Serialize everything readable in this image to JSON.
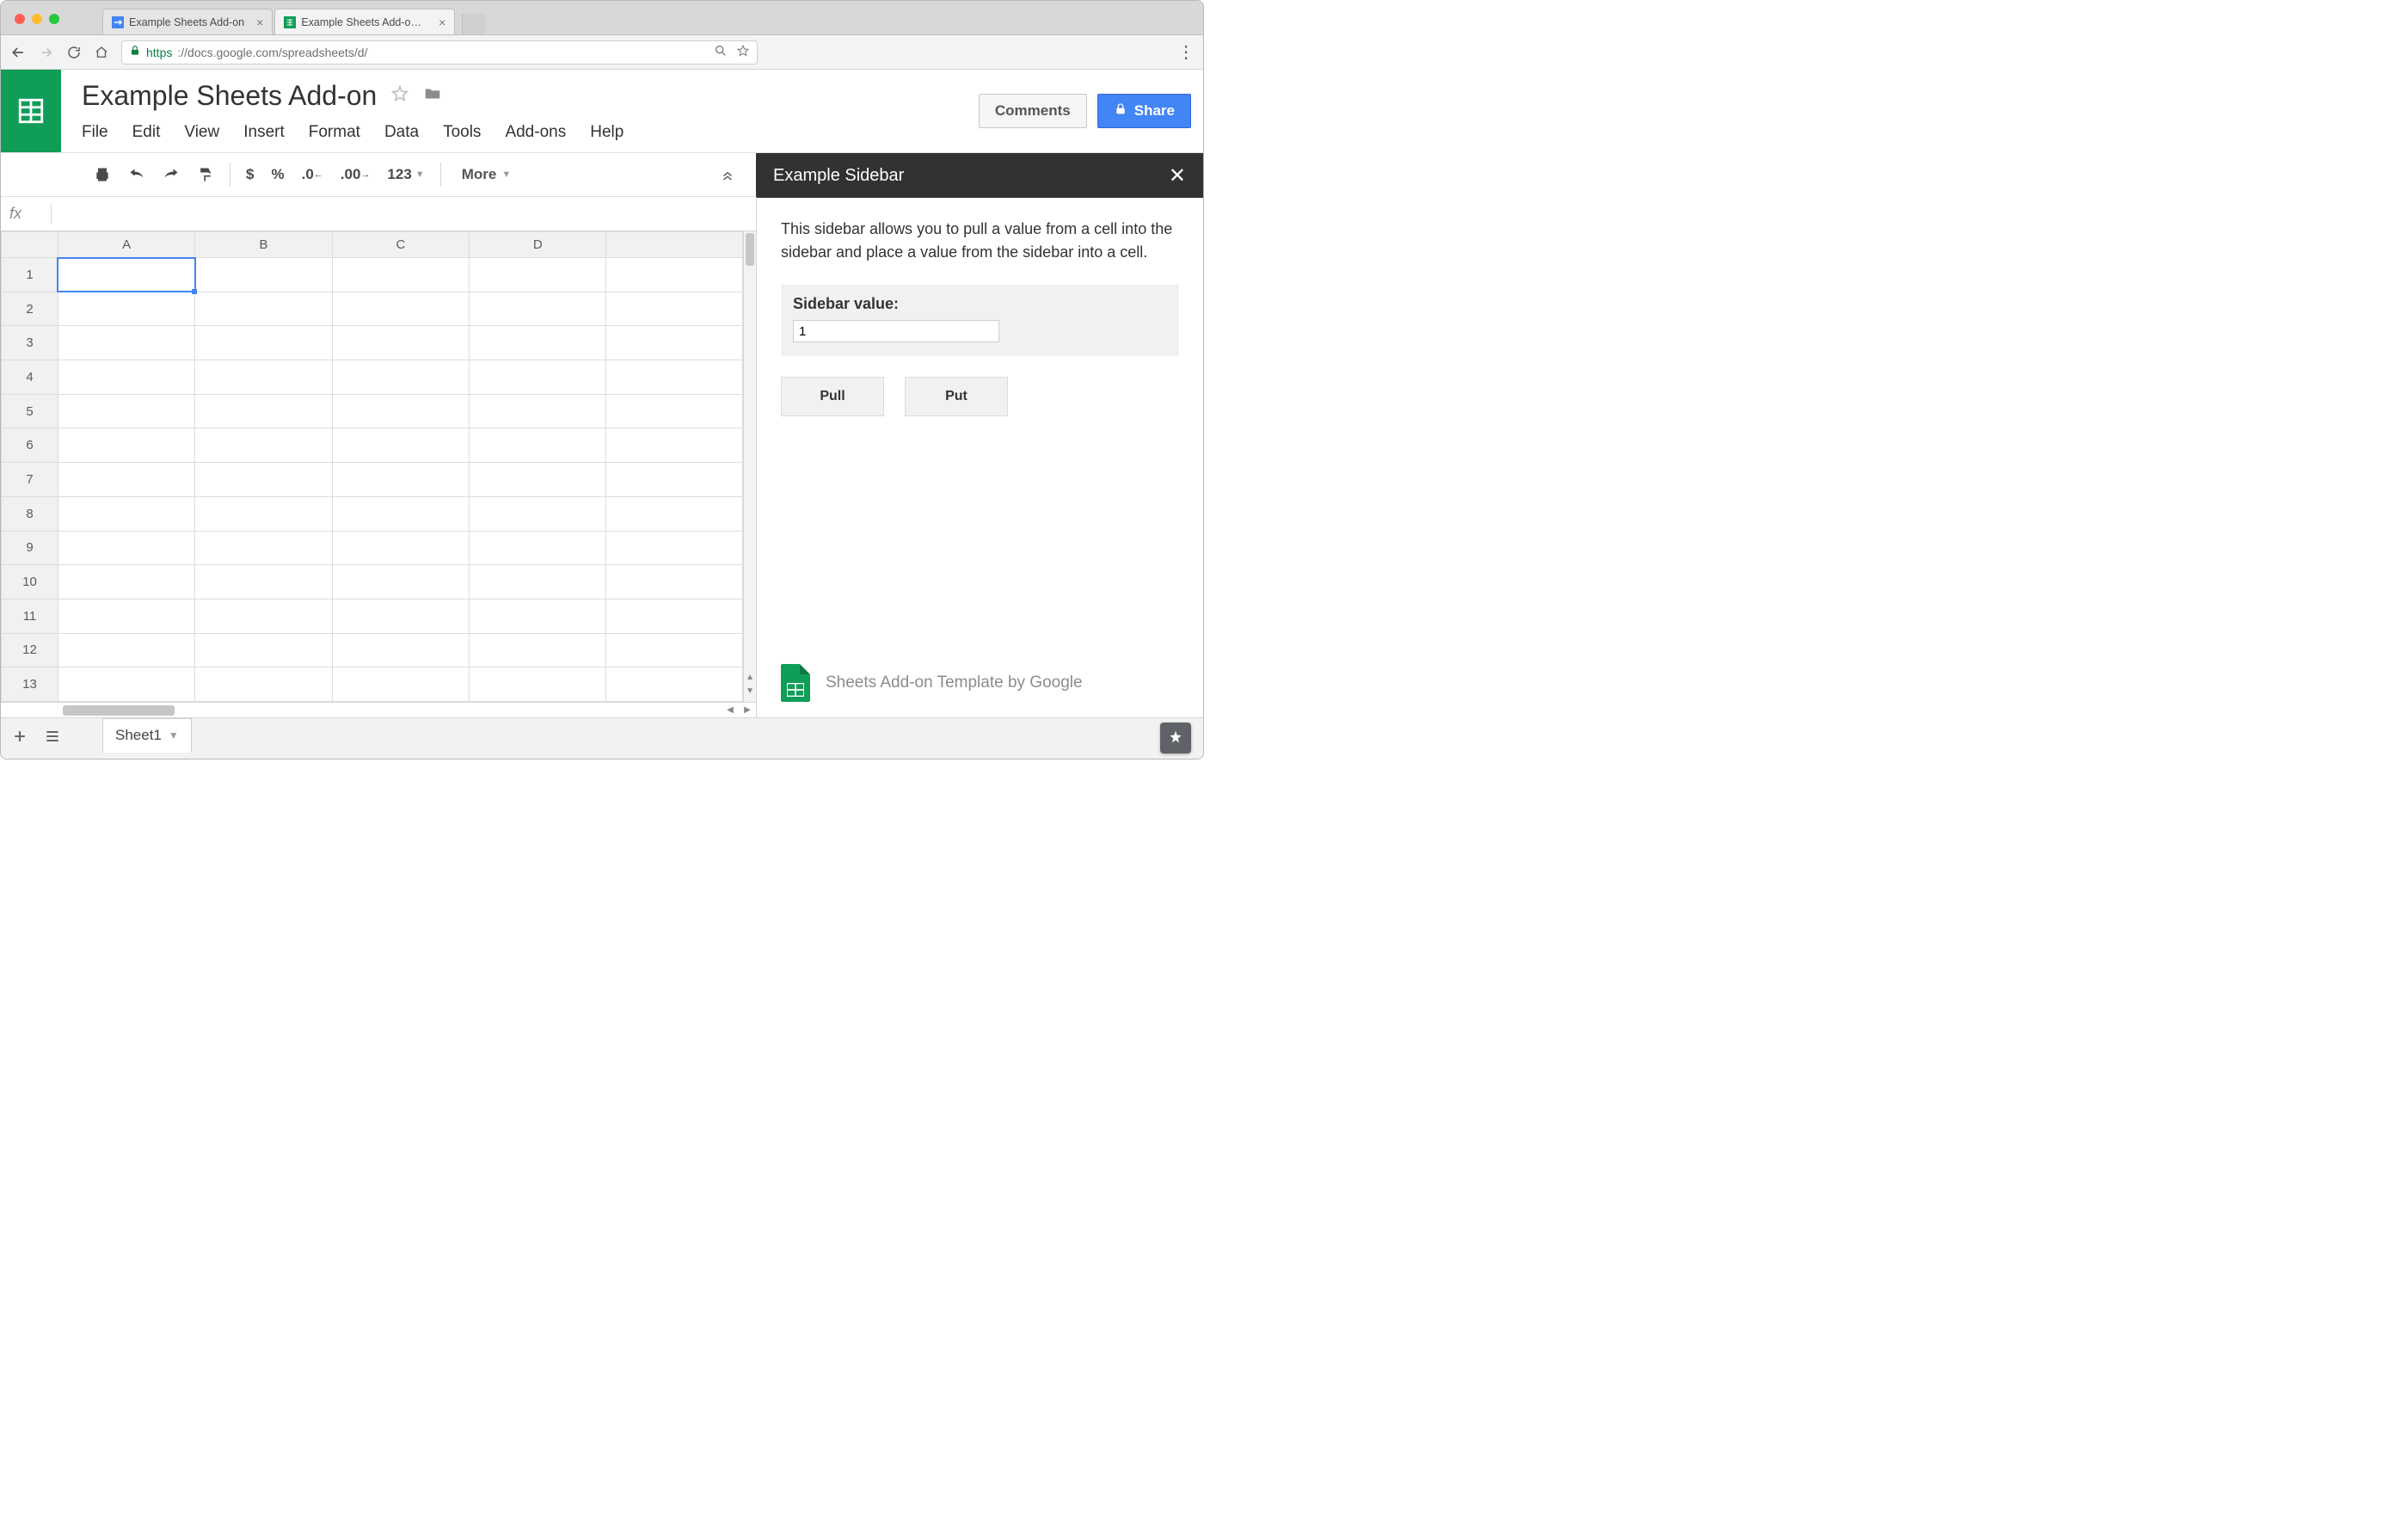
{
  "browser": {
    "tabs": [
      {
        "label": "Example Sheets Add-on"
      },
      {
        "label": "Example Sheets Add-on - Goo…"
      }
    ],
    "url_protocol": "https",
    "url_rest": "://docs.google.com/spreadsheets/d/"
  },
  "doc": {
    "title": "Example Sheets Add-on",
    "menus": [
      "File",
      "Edit",
      "View",
      "Insert",
      "Format",
      "Data",
      "Tools",
      "Add-ons",
      "Help"
    ],
    "comments_btn": "Comments",
    "share_btn": "Share"
  },
  "toolbar": {
    "currency": "$",
    "percent": "%",
    "dec_less": ".0",
    "dec_more": ".00",
    "num_fmt": "123",
    "more": "More"
  },
  "sidebar": {
    "title": "Example Sidebar",
    "description": "This sidebar allows you to pull a value from a cell into the sidebar and place a value from the sidebar into a cell.",
    "box_label": "Sidebar value:",
    "box_value": "1",
    "pull_btn": "Pull",
    "put_btn": "Put",
    "footer": "Sheets Add-on Template by Google"
  },
  "grid": {
    "columns": [
      "A",
      "B",
      "C",
      "D",
      ""
    ],
    "rows": [
      "1",
      "2",
      "3",
      "4",
      "5",
      "6",
      "7",
      "8",
      "9",
      "10",
      "11",
      "12",
      "13"
    ]
  },
  "sheet_tabs": {
    "active": "Sheet1"
  }
}
